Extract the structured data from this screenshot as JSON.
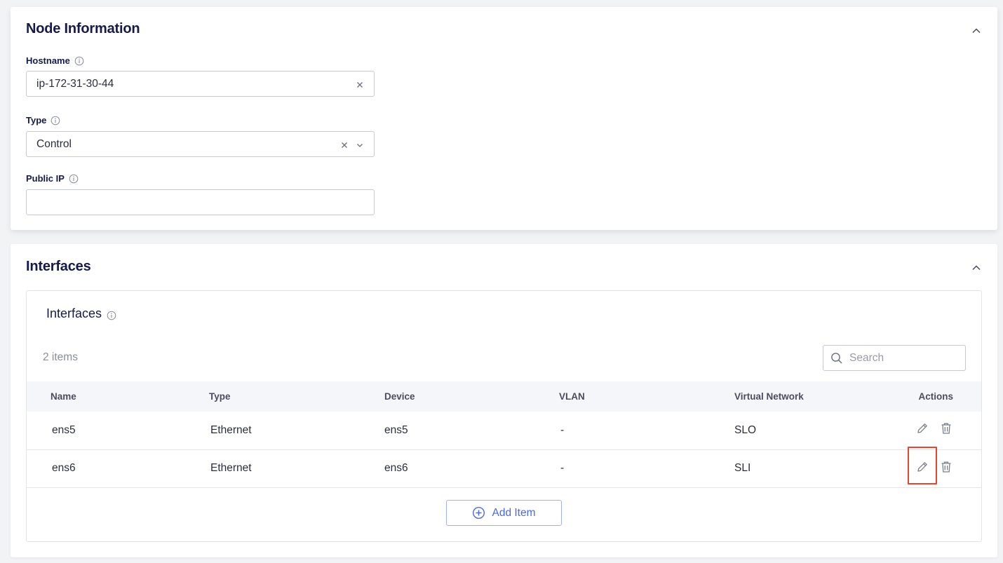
{
  "node_info": {
    "title": "Node Information",
    "hostname": {
      "label": "Hostname",
      "value": "ip-172-31-30-44"
    },
    "type": {
      "label": "Type",
      "value": "Control"
    },
    "public_ip": {
      "label": "Public IP",
      "value": ""
    }
  },
  "interfaces": {
    "section_title": "Interfaces",
    "list_title": "Interfaces",
    "count": "2 items",
    "search_placeholder": "Search",
    "columns": {
      "name": "Name",
      "type": "Type",
      "device": "Device",
      "vlan": "VLAN",
      "virtual_network": "Virtual Network",
      "actions": "Actions"
    },
    "rows": [
      {
        "name": "ens5",
        "type": "Ethernet",
        "device": "ens5",
        "vlan": "-",
        "virtual_network": "SLO"
      },
      {
        "name": "ens6",
        "type": "Ethernet",
        "device": "ens6",
        "vlan": "-",
        "virtual_network": "SLI"
      }
    ],
    "add_item_label": "Add Item"
  },
  "colors": {
    "heading": "#161a49",
    "accent": "#4a68e8",
    "highlight": "#e8432e"
  }
}
